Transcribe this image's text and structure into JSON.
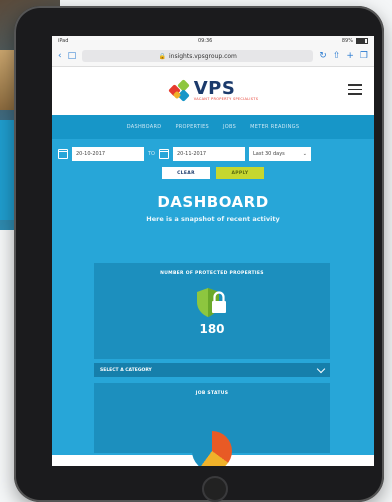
{
  "status_bar": {
    "left": "iPad",
    "time": "09:36",
    "battery": "89%"
  },
  "browser": {
    "url": "insights.vpsgroup.com",
    "tabs_icon": "tabs-icon",
    "lock_icon": "lock-icon"
  },
  "brand": {
    "name": "VPS",
    "tagline": "VACANT PROPERTY SPECIALISTS"
  },
  "nav": {
    "items": [
      "DASHBOARD",
      "PROPERTIES",
      "JOBS",
      "METER READINGS"
    ]
  },
  "filters": {
    "from_date": "20-10-2017",
    "to_label": "TO",
    "to_date": "20-11-2017",
    "range_select": "Last 30 days",
    "clear_label": "CLEAR",
    "apply_label": "APPLY"
  },
  "dashboard": {
    "title": "DASHBOARD",
    "subtitle": "Here is a snapshot of recent activity"
  },
  "protected_card": {
    "title": "NUMBER OF PROTECTED PROPERTIES",
    "count": "180"
  },
  "category_select": {
    "label": "SELECT A CATEGORY"
  },
  "job_card": {
    "title": "JOB STATUS"
  },
  "colors": {
    "brand_blue": "#1b3a6b",
    "nav_blue": "#1796c8",
    "main_blue": "#27a6d8",
    "card_blue": "#1c8fbe",
    "apply_green": "#c6d72f",
    "shield_green": "#8dc63f"
  }
}
